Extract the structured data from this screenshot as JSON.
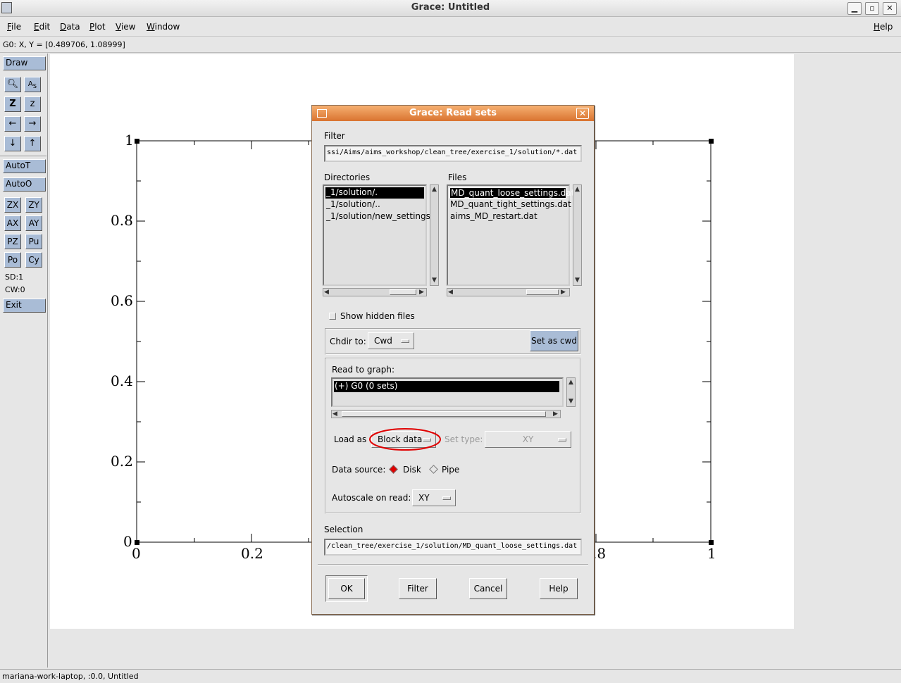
{
  "window": {
    "title": "Grace: Untitled"
  },
  "menu": [
    "File",
    "Edit",
    "Data",
    "Plot",
    "View",
    "Window"
  ],
  "help_menu": "Help",
  "coords": "G0: X, Y = [0.489706, 1.08999]",
  "toolbar": {
    "draw": "Draw",
    "autot": "AutoT",
    "autoo": "AutoO",
    "zx": "ZX",
    "zy": "ZY",
    "ax": "AX",
    "ay": "AY",
    "pz": "PZ",
    "pu": "Pu",
    "po": "Po",
    "cy": "Cy",
    "sd": "SD:1",
    "cw": "CW:0",
    "exit": "Exit"
  },
  "plot": {
    "y_ticks": [
      "1",
      "0.8",
      "0.6",
      "0.4",
      "0.2",
      "0"
    ],
    "x_ticks": [
      "0",
      "0.2",
      ".8",
      "1"
    ]
  },
  "status": "mariana-work-laptop, :0.0, Untitled",
  "dialog": {
    "title": "Grace: Read sets",
    "filter_label": "Filter",
    "filter_value": "ssi/Aims/aims_workshop/clean_tree/exercise_1/solution/*.dat",
    "directories_label": "Directories",
    "directories": [
      "_1/solution/.",
      "_1/solution/..",
      "_1/solution/new_settings"
    ],
    "files_label": "Files",
    "files": [
      "MD_quant_loose_settings.dat",
      "MD_quant_tight_settings.dat",
      "aims_MD_restart.dat"
    ],
    "show_hidden": "Show hidden files",
    "chdir_label": "Chdir to:",
    "chdir_value": "Cwd",
    "set_cwd": "Set as cwd",
    "read_to_graph": "Read to graph:",
    "graphs": [
      "(+) G0 (0 sets)"
    ],
    "load_as_label": "Load as",
    "load_as_value": "Block data",
    "set_type_label": "Set type:",
    "set_type_value": "XY",
    "data_source_label": "Data source:",
    "source_disk": "Disk",
    "source_pipe": "Pipe",
    "autoscale_label": "Autoscale on read:",
    "autoscale_value": "XY",
    "selection_label": "Selection",
    "selection_value": "/clean_tree/exercise_1/solution/MD_quant_loose_settings.dat",
    "buttons": {
      "ok": "OK",
      "filter": "Filter",
      "cancel": "Cancel",
      "help": "Help"
    }
  },
  "colors": {
    "dialog_title": "#e08240",
    "highlight_circle": "#e00000",
    "toolbar_button": "#a9bcd6"
  }
}
